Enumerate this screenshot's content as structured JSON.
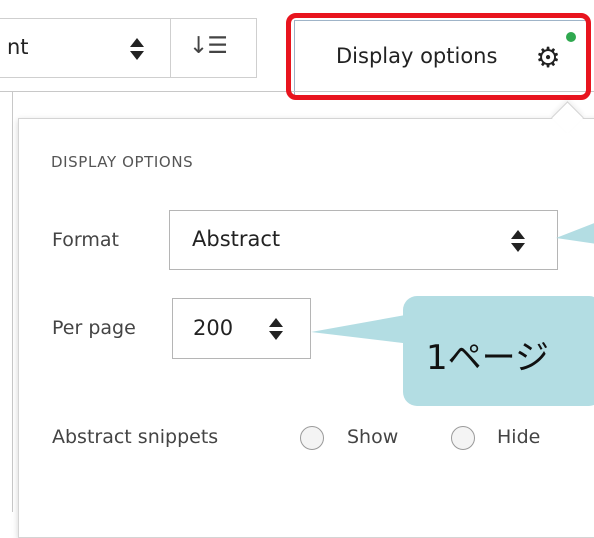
{
  "toolbar": {
    "sort_value": "nt",
    "order_glyph": "↓☰",
    "display_button_label": "Display options"
  },
  "panel": {
    "title": "DISPLAY OPTIONS",
    "format_label": "Format",
    "format_value": "Abstract",
    "per_page_label": "Per page",
    "per_page_value": "200",
    "snippets_label": "Abstract snippets",
    "show_label": "Show",
    "hide_label": "Hide"
  },
  "callout": {
    "text": "1ページ"
  },
  "colors": {
    "highlight": "#e8141e",
    "callout": "#b3dde3",
    "indicator_dot": "#2fa84f"
  }
}
